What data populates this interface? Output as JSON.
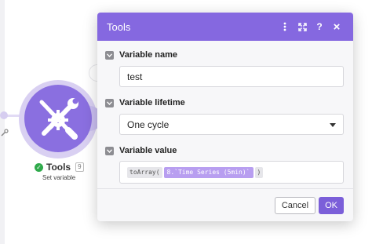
{
  "module": {
    "title": "Tools",
    "badge": "9",
    "subtitle": "Set variable",
    "status": "success"
  },
  "dialog": {
    "title": "Tools",
    "header_icons": [
      "more-vertical-icon",
      "expand-icon",
      "help-icon",
      "close-icon"
    ],
    "help_glyph": "?",
    "close_glyph": "×",
    "fields": {
      "variable_name": {
        "label": "Variable name",
        "value": "test"
      },
      "variable_lifetime": {
        "label": "Variable lifetime",
        "value": "One cycle"
      },
      "variable_value": {
        "label": "Variable value",
        "fn_open": "toArray(",
        "variable_pill": "8.`Time Series (5min)`",
        "fn_close": ")"
      }
    },
    "buttons": {
      "cancel": "Cancel",
      "ok": "OK"
    }
  },
  "colors": {
    "header": "#8568e0",
    "module": "#8a6fe0",
    "ok_button": "#7b5fd9",
    "pill": "#b89ef0",
    "status_success": "#2faa4b"
  }
}
